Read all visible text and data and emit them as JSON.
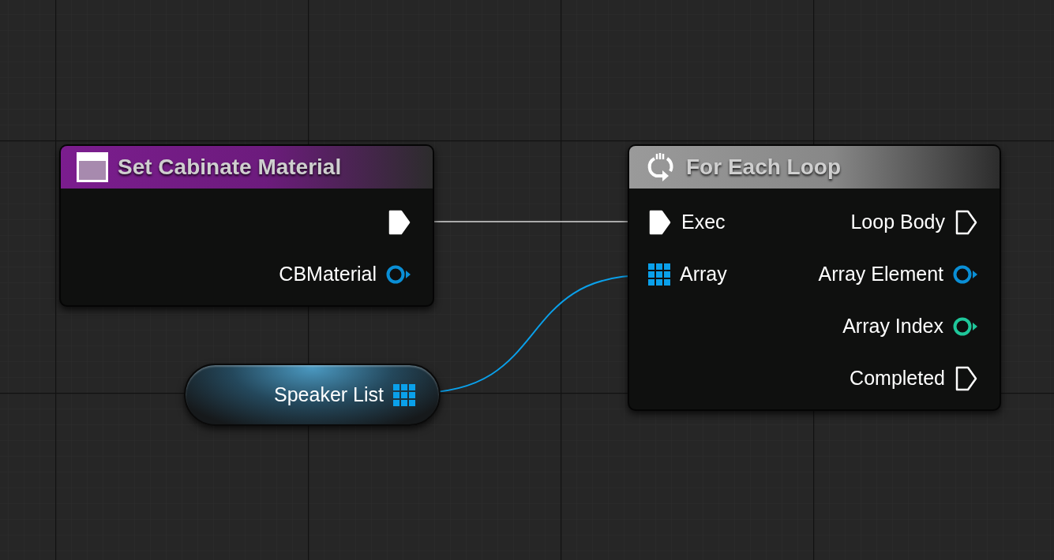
{
  "nodes": [
    {
      "kind": "function",
      "title": "Set Cabinate Material",
      "color": "#7b1d8e",
      "outputs": [
        {
          "kind": "exec",
          "color": "#ffffff",
          "connected": true
        },
        {
          "kind": "object",
          "label": "CBMaterial",
          "color": "#0a8fd6",
          "connected": false
        }
      ]
    },
    {
      "kind": "macro",
      "title": "For Each Loop",
      "color": "#9a9a9a",
      "inputs": [
        {
          "kind": "exec",
          "label": "Exec",
          "color": "#ffffff",
          "connected": true
        },
        {
          "kind": "array",
          "label": "Array",
          "color": "#0aa0ea",
          "connected": true
        }
      ],
      "outputs": [
        {
          "kind": "exec",
          "label": "Loop Body",
          "color": "#ffffff",
          "connected": false
        },
        {
          "kind": "object",
          "label": "Array Element",
          "color": "#0a8fd6",
          "connected": false
        },
        {
          "kind": "int",
          "label": "Array Index",
          "color": "#1fc79a",
          "connected": false
        },
        {
          "kind": "exec",
          "label": "Completed",
          "color": "#ffffff",
          "connected": false
        }
      ]
    }
  ],
  "variable_node": {
    "label": "Speaker List",
    "pin": {
      "kind": "array",
      "color": "#0aa0ea",
      "connected": true
    }
  }
}
